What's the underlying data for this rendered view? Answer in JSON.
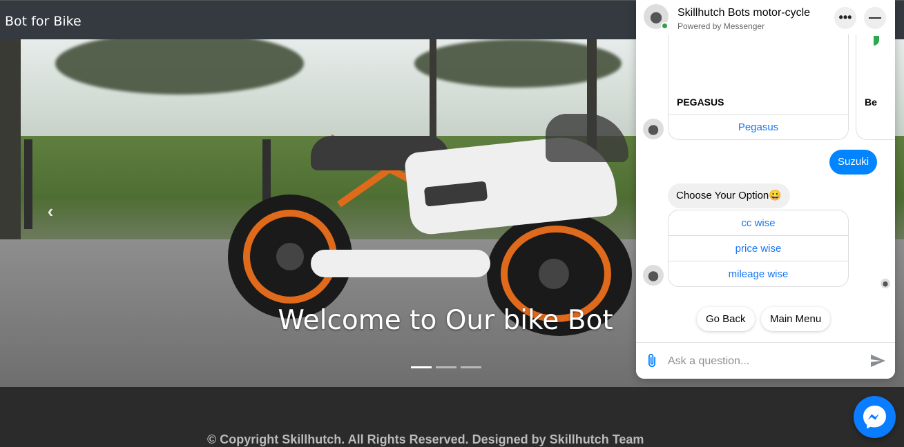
{
  "navbar": {
    "brand": "Bot for Bike"
  },
  "hero": {
    "prev_icon": "chevron-left-icon",
    "caption": "Welcome to Our bike Bot",
    "slides_total": 3,
    "active_slide": 1
  },
  "footer": {
    "text": "© Copyright Skillhutch. All Rights Reserved. Designed by Skillhutch Team"
  },
  "chat": {
    "title": "Skillhutch Bots motor-cycle",
    "subtitle": "Powered by Messenger",
    "more_icon": "more-dots-icon",
    "minimize_icon": "minimize-icon",
    "cards": [
      {
        "title": "PEGASUS",
        "button": "Pegasus"
      },
      {
        "title": "Be"
      }
    ],
    "user_message": "Suzuki",
    "bot_message": "Choose Your Option😀",
    "options": [
      "cc wise",
      "price wise",
      "mileage wise"
    ],
    "quick_replies": [
      "Go Back",
      "Main Menu"
    ],
    "composer": {
      "placeholder": "Ask a question...",
      "attach_icon": "paperclip-icon",
      "send_icon": "send-icon"
    }
  },
  "messenger_fab": {
    "icon": "messenger-icon"
  },
  "colors": {
    "navbar": "#343a40",
    "messenger_blue": "#0084ff",
    "link_blue": "#1877f2"
  }
}
